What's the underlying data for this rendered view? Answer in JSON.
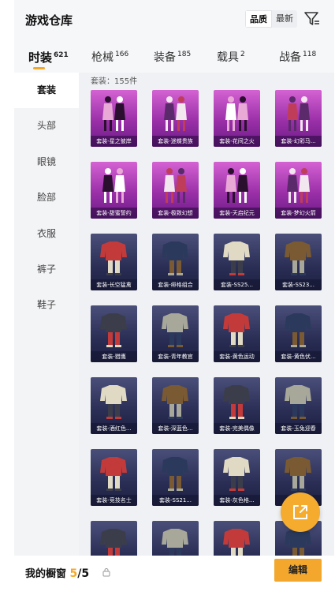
{
  "header": {
    "title": "游戏仓库",
    "sort_options": [
      "品质",
      "最新"
    ],
    "sort_selected": "品质",
    "filter_icon": "filter-icon"
  },
  "tabs": [
    {
      "label": "时装",
      "count": "621",
      "active": true
    },
    {
      "label": "枪械",
      "count": "166",
      "active": false
    },
    {
      "label": "装备",
      "count": "185",
      "active": false
    },
    {
      "label": "载具",
      "count": "2",
      "active": false
    },
    {
      "label": "战备",
      "count": "118",
      "active": false
    }
  ],
  "sidenav": [
    "套装",
    "头部",
    "眼镜",
    "脸部",
    "衣服",
    "裤子",
    "鞋子"
  ],
  "content": {
    "count_text": "套装：155件"
  },
  "items": [
    {
      "label": "套装-星之彼岸",
      "tone": "purple"
    },
    {
      "label": "套装-迷蝶贵族",
      "tone": "purple"
    },
    {
      "label": "套装-花间之火",
      "tone": "purple"
    },
    {
      "label": "套装-幻彩马...",
      "tone": "purple"
    },
    {
      "label": "套装-甜蜜誓约",
      "tone": "purple"
    },
    {
      "label": "套装-极致幻想",
      "tone": "purple"
    },
    {
      "label": "套装-天启纪元",
      "tone": "purple"
    },
    {
      "label": "套装-梦幻火箭",
      "tone": "purple"
    },
    {
      "label": "套装-长空猛禽",
      "tone": "navy"
    },
    {
      "label": "套装-绯格组合",
      "tone": "navy"
    },
    {
      "label": "套装-SS25...",
      "tone": "navy"
    },
    {
      "label": "套装-SS23...",
      "tone": "navy"
    },
    {
      "label": "套装-猎鹰",
      "tone": "navy"
    },
    {
      "label": "套装-青年教官",
      "tone": "navy"
    },
    {
      "label": "套装-黄色运动",
      "tone": "navy"
    },
    {
      "label": "套装-黄色伏...",
      "tone": "navy"
    },
    {
      "label": "套装-酒红色...",
      "tone": "navy"
    },
    {
      "label": "套装-深蓝色...",
      "tone": "navy"
    },
    {
      "label": "套装-完美偶像",
      "tone": "navy"
    },
    {
      "label": "套装-玉兔迎春",
      "tone": "navy"
    },
    {
      "label": "套装-竞技名士",
      "tone": "navy"
    },
    {
      "label": "套装-SS21...",
      "tone": "navy"
    },
    {
      "label": "套装-灰色格...",
      "tone": "navy"
    },
    {
      "label": "角",
      "tone": "navy"
    },
    {
      "label": "",
      "tone": "navy"
    },
    {
      "label": "",
      "tone": "navy"
    },
    {
      "label": "",
      "tone": "navy"
    },
    {
      "label": "",
      "tone": "navy"
    }
  ],
  "bottom": {
    "showcase_label": "我的橱窗",
    "showcase_current": "5",
    "showcase_total": "/5",
    "edit_label": "编辑"
  },
  "colors": {
    "accent": "#f4a82a",
    "card_purple": "#b13fbf",
    "card_navy": "#2a2e55"
  },
  "share_icon": "share-icon"
}
